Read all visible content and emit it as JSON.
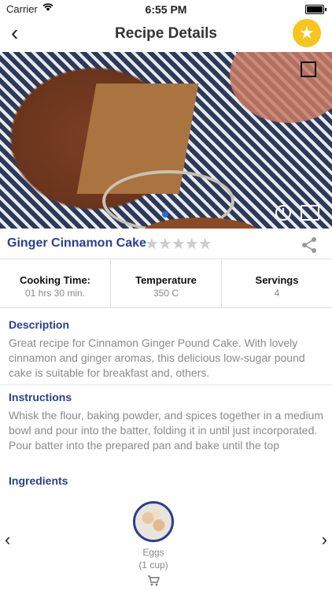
{
  "status_bar": {
    "carrier": "Carrier",
    "time": "6:55 PM"
  },
  "nav": {
    "title": "Recipe Details",
    "back_icon": "‹",
    "favorite_icon": "★"
  },
  "recipe": {
    "name": "Ginger Cinnamon Cake",
    "rating_stars": "★★★★★",
    "rating_value": 0
  },
  "info": [
    {
      "label": "Cooking Time:",
      "value": "01 hrs 30 min."
    },
    {
      "label": "Temperature",
      "value": "350 C"
    },
    {
      "label": "Servings",
      "value": "4"
    }
  ],
  "description": {
    "title": "Description",
    "body": "Great recipe for Cinnamon Ginger Pound Cake. With lovely cinnamon and ginger aromas, this delicious low-sugar pound cake is suitable for breakfast and, others."
  },
  "instructions": {
    "title": "Instructions",
    "body": "Whisk the flour, baking powder, and spices together in a medium bowl and pour into the batter, folding it in until just incorporated. Pour batter into the prepared pan and bake until the top"
  },
  "ingredients": {
    "title": "Ingredients",
    "prev_icon": "‹",
    "next_icon": "›",
    "items": [
      {
        "name": "Eggs",
        "qty": "(1 cup)"
      }
    ]
  },
  "colors": {
    "accent": "#2a3f8f",
    "star": "#f7c51e",
    "muted": "#8a8a8a"
  }
}
